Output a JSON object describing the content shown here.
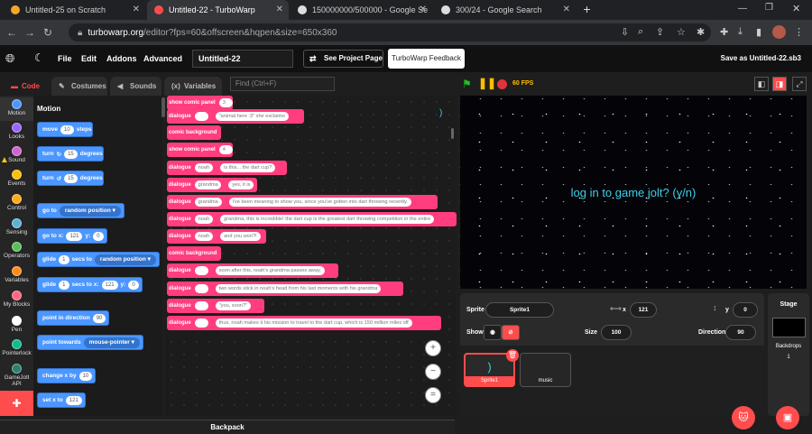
{
  "browser": {
    "tabs": [
      {
        "title": "Untitled-25 on Scratch",
        "fav": "#f5a623"
      },
      {
        "title": "Untitled-22 - TurboWarp",
        "fav": "#ff4c4c"
      },
      {
        "title": "150000000/500000 - Google Se",
        "fav": "#ddd"
      },
      {
        "title": "300/24 - Google Search",
        "fav": "#ddd"
      }
    ],
    "url_host": "turbowarp.org",
    "url_rest": "/editor?fps=60&offscreen&hqpen&size=650x360"
  },
  "menu": {
    "file": "File",
    "edit": "Edit",
    "addons": "Addons",
    "advanced": "Advanced",
    "project_title": "Untitled-22",
    "see_project": "See Project Page",
    "feedback": "TurboWarp Feedback",
    "save_as": "Save as Untitled-22.sb3"
  },
  "editor_tabs": {
    "code": "Code",
    "costumes": "Costumes",
    "sounds": "Sounds",
    "variables": "Variables",
    "find_placeholder": "Find (Ctrl+F)"
  },
  "categories": [
    {
      "label": "Motion",
      "color": "#4c97ff"
    },
    {
      "label": "Looks",
      "color": "#9966ff"
    },
    {
      "label": "Sound",
      "color": "#cf63cf"
    },
    {
      "label": "Events",
      "color": "#ffbf00"
    },
    {
      "label": "Control",
      "color": "#ffab19"
    },
    {
      "label": "Sensing",
      "color": "#5cb1d6"
    },
    {
      "label": "Operators",
      "color": "#59c059"
    },
    {
      "label": "Variables",
      "color": "#ff8c1a"
    },
    {
      "label": "My Blocks",
      "color": "#ff6680"
    },
    {
      "label": "Pen",
      "color": "#0fbd8c"
    },
    {
      "label": "Pointerlock",
      "color": "#0fbd8c"
    },
    {
      "label": "GameJolt API",
      "color": "#2f7f6f"
    }
  ],
  "palette": {
    "title": "Motion",
    "move": {
      "a": "move",
      "v": "10",
      "b": "steps"
    },
    "turn_right": {
      "a": "turn",
      "v": "15",
      "b": "degrees"
    },
    "turn_left": {
      "a": "turn",
      "v": "15",
      "b": "degrees"
    },
    "goto": {
      "a": "go to",
      "dd": "random position"
    },
    "goto_xy": {
      "a": "go to x:",
      "x": "121",
      "b": "y:",
      "y": "0"
    },
    "glide": {
      "a": "glide",
      "v": "1",
      "b": "secs to",
      "dd": "random position"
    },
    "glide_xy": {
      "a": "glide",
      "v": "1",
      "b": "secs to x:",
      "x": "121",
      "c": "y:",
      "y": "0"
    },
    "point_dir": {
      "a": "point in direction",
      "v": "90"
    },
    "point_towards": {
      "a": "point towards",
      "dd": "mouse-pointer"
    },
    "change_x": {
      "a": "change x by",
      "v": "10"
    },
    "set_x": {
      "a": "set x to",
      "v": "121"
    }
  },
  "script": [
    {
      "a": "show comic panel",
      "v": "3"
    },
    {
      "a": "dialogue",
      "v": "",
      "t": "\"animal here :3\" she exclaims"
    },
    {
      "a": "comic background"
    },
    {
      "a": "show comic panel",
      "v": "4"
    },
    {
      "a": "dialogue",
      "v": "noah",
      "t": "is this... the dart cup?"
    },
    {
      "a": "dialogue",
      "v": "grandma",
      "t": "yes, it is"
    },
    {
      "a": "dialogue",
      "v": "grandma",
      "t": "i've been meaning to show you, since you've gotten into dart throwing recently."
    },
    {
      "a": "dialogue",
      "v": "noah",
      "t": "grandma, this is incredible! the dart cup is the greatest dart throwing competition in the entire"
    },
    {
      "a": "dialogue",
      "v": "noah",
      "t": "and you won?!"
    },
    {
      "a": "comic background"
    },
    {
      "a": "dialogue",
      "v": "",
      "t": "soon after this, noah's grandma passes away."
    },
    {
      "a": "dialogue",
      "v": "",
      "t": "two words stick in noah's head from his last moments with his grandma"
    },
    {
      "a": "dialogue",
      "v": "",
      "t": "\"you, soon?\""
    },
    {
      "a": "dialogue",
      "v": "",
      "t": "thus, noah makes it his mission to travel to the dart cup, which is 150 million miles off"
    }
  ],
  "stray_text": ")",
  "backpack": "Backpack",
  "stage": {
    "fps": "60 FPS",
    "text": "log in to game jolt? (y/n)"
  },
  "sprite_info": {
    "sprite_label": "Sprite",
    "sprite_name": "Sprite1",
    "x_label": "x",
    "x": "121",
    "y_label": "y",
    "y": "0",
    "show_label": "Show",
    "size_label": "Size",
    "size": "100",
    "direction_label": "Direction",
    "direction": "90"
  },
  "sprites": [
    {
      "name": "Sprite1",
      "glyph": ")"
    },
    {
      "name": "music",
      "glyph": ""
    }
  ],
  "stage_pane": {
    "title": "Stage",
    "backdrops_label": "Backdrops",
    "backdrops": "1"
  }
}
